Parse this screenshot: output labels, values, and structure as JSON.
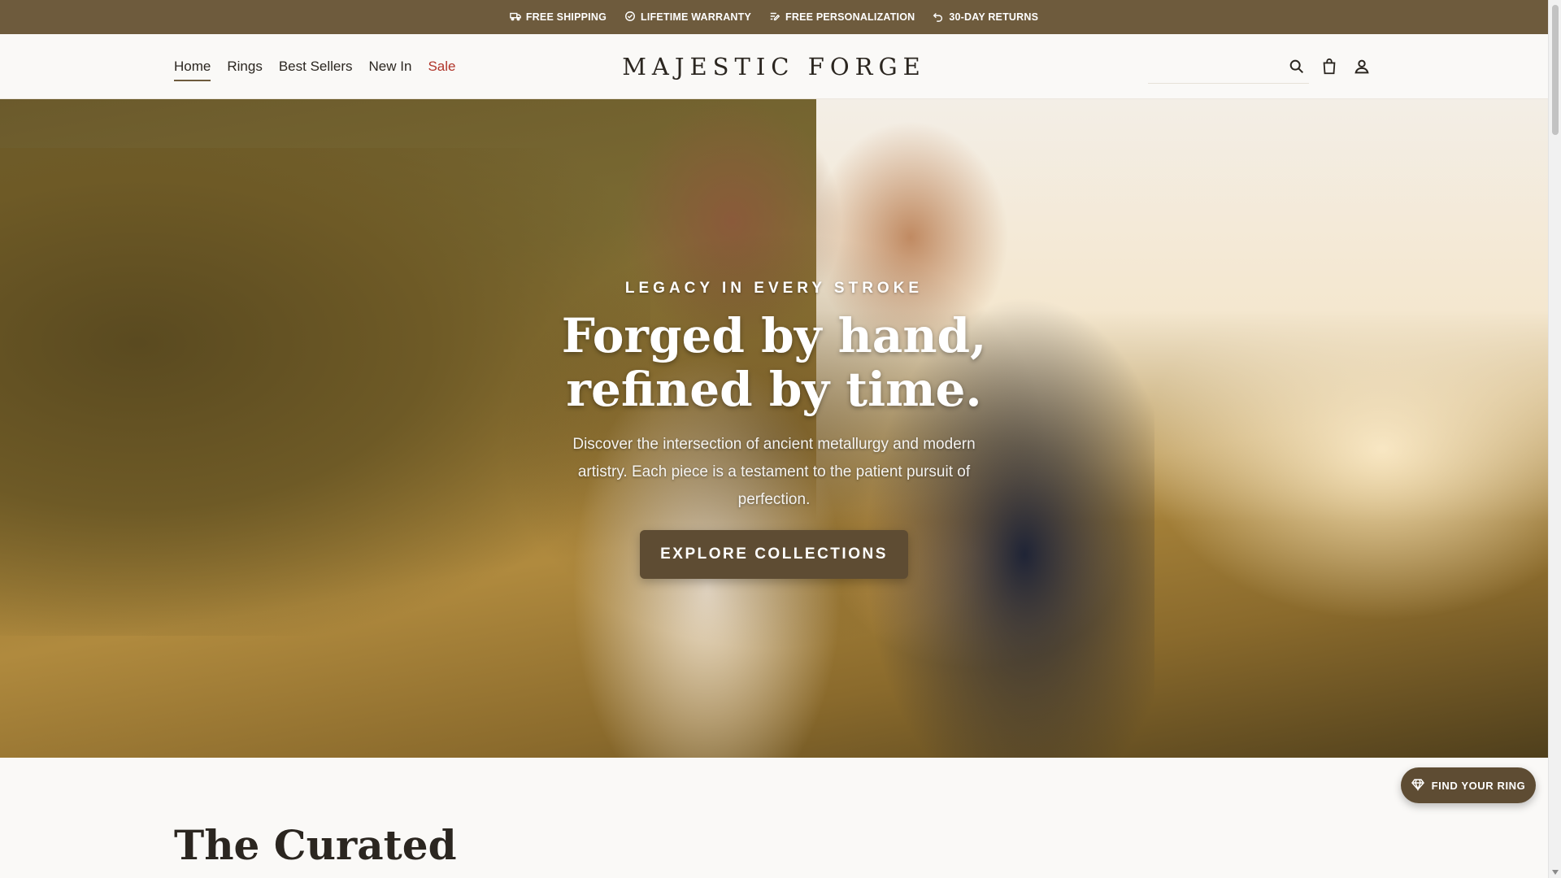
{
  "announcement": {
    "items": [
      {
        "icon": "truck-icon",
        "label": "FREE SHIPPING"
      },
      {
        "icon": "check-badge-icon",
        "label": "LIFETIME WARRANTY"
      },
      {
        "icon": "pen-icon",
        "label": "FREE PERSONALIZATION"
      },
      {
        "icon": "return-arrow-icon",
        "label": "30-DAY RETURNS"
      }
    ],
    "background": "#6e5b3d"
  },
  "header": {
    "brand": "MAJESTIC FORGE",
    "nav": [
      {
        "label": "Home",
        "active": true
      },
      {
        "label": "Rings"
      },
      {
        "label": "Best Sellers"
      },
      {
        "label": "New In"
      },
      {
        "label": "Sale",
        "color": "#b0352a"
      }
    ],
    "icons": [
      "search-icon",
      "shopping-bag-icon",
      "user-icon"
    ]
  },
  "hero": {
    "eyebrow": "LEGACY IN EVERY STROKE",
    "headline_line1": "Forged by hand,",
    "headline_line2": "refined by time.",
    "description": "Discover the intersection of ancient metallurgy and modern artistry. Each piece is a testament to the patient pursuit of perfection.",
    "cta_label": "EXPLORE COLLECTIONS",
    "cta_color": "#5e4c33"
  },
  "section": {
    "title": "The Curated"
  },
  "floating": {
    "label": "FIND YOUR RING",
    "icon": "diamond-icon"
  }
}
